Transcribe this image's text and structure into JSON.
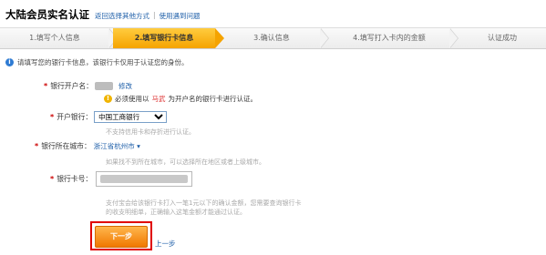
{
  "header": {
    "title": "大陆会员实名认证",
    "links": [
      "返回选择其他方式",
      "使用遇到问题"
    ]
  },
  "steps": [
    "1.填写个人信息",
    "2.填写银行卡信息",
    "3.确认信息",
    "4.填写打入卡内的金额",
    "认证成功"
  ],
  "notice": "请填写您的银行卡信息，该银行卡仅用于认证您的身份。",
  "form": {
    "holder": {
      "label": "银行开户名：",
      "edit": "修改",
      "warning_pre": "必须使用以",
      "warning_hl": "马武",
      "warning_post": "为开户名的银行卡进行认证。"
    },
    "bank": {
      "label": "开户银行：",
      "selected": "中国工商银行",
      "hint": "不支持信用卡和存折进行认证。"
    },
    "city": {
      "label": "银行所在城市：",
      "value": "浙江省杭州市",
      "hint": "如果找不到所在城市，可以选择所在地区或者上级城市。"
    },
    "card": {
      "label": "银行卡号：",
      "hint_line1": "支付宝会给该银行卡打入一笔1元以下的确认金额，您需要查询银行卡",
      "hint_line2": "的收支明细单，正确输入这笔金额才能通过认证。"
    }
  },
  "next_button": "下一步",
  "back_link": "上一步"
}
